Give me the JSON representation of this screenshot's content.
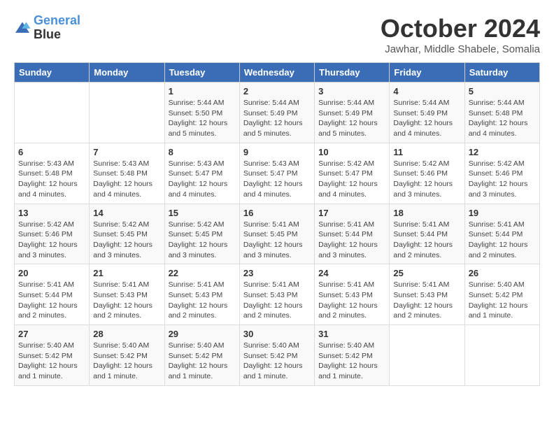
{
  "logo": {
    "line1": "General",
    "line2": "Blue"
  },
  "title": "October 2024",
  "subtitle": "Jawhar, Middle Shabele, Somalia",
  "weekdays": [
    "Sunday",
    "Monday",
    "Tuesday",
    "Wednesday",
    "Thursday",
    "Friday",
    "Saturday"
  ],
  "weeks": [
    [
      null,
      null,
      {
        "day": "1",
        "sunrise": "5:44 AM",
        "sunset": "5:50 PM",
        "daylight": "12 hours and 5 minutes."
      },
      {
        "day": "2",
        "sunrise": "5:44 AM",
        "sunset": "5:49 PM",
        "daylight": "12 hours and 5 minutes."
      },
      {
        "day": "3",
        "sunrise": "5:44 AM",
        "sunset": "5:49 PM",
        "daylight": "12 hours and 5 minutes."
      },
      {
        "day": "4",
        "sunrise": "5:44 AM",
        "sunset": "5:49 PM",
        "daylight": "12 hours and 4 minutes."
      },
      {
        "day": "5",
        "sunrise": "5:44 AM",
        "sunset": "5:48 PM",
        "daylight": "12 hours and 4 minutes."
      }
    ],
    [
      {
        "day": "6",
        "sunrise": "5:43 AM",
        "sunset": "5:48 PM",
        "daylight": "12 hours and 4 minutes."
      },
      {
        "day": "7",
        "sunrise": "5:43 AM",
        "sunset": "5:48 PM",
        "daylight": "12 hours and 4 minutes."
      },
      {
        "day": "8",
        "sunrise": "5:43 AM",
        "sunset": "5:47 PM",
        "daylight": "12 hours and 4 minutes."
      },
      {
        "day": "9",
        "sunrise": "5:43 AM",
        "sunset": "5:47 PM",
        "daylight": "12 hours and 4 minutes."
      },
      {
        "day": "10",
        "sunrise": "5:42 AM",
        "sunset": "5:47 PM",
        "daylight": "12 hours and 4 minutes."
      },
      {
        "day": "11",
        "sunrise": "5:42 AM",
        "sunset": "5:46 PM",
        "daylight": "12 hours and 3 minutes."
      },
      {
        "day": "12",
        "sunrise": "5:42 AM",
        "sunset": "5:46 PM",
        "daylight": "12 hours and 3 minutes."
      }
    ],
    [
      {
        "day": "13",
        "sunrise": "5:42 AM",
        "sunset": "5:46 PM",
        "daylight": "12 hours and 3 minutes."
      },
      {
        "day": "14",
        "sunrise": "5:42 AM",
        "sunset": "5:45 PM",
        "daylight": "12 hours and 3 minutes."
      },
      {
        "day": "15",
        "sunrise": "5:42 AM",
        "sunset": "5:45 PM",
        "daylight": "12 hours and 3 minutes."
      },
      {
        "day": "16",
        "sunrise": "5:41 AM",
        "sunset": "5:45 PM",
        "daylight": "12 hours and 3 minutes."
      },
      {
        "day": "17",
        "sunrise": "5:41 AM",
        "sunset": "5:44 PM",
        "daylight": "12 hours and 3 minutes."
      },
      {
        "day": "18",
        "sunrise": "5:41 AM",
        "sunset": "5:44 PM",
        "daylight": "12 hours and 2 minutes."
      },
      {
        "day": "19",
        "sunrise": "5:41 AM",
        "sunset": "5:44 PM",
        "daylight": "12 hours and 2 minutes."
      }
    ],
    [
      {
        "day": "20",
        "sunrise": "5:41 AM",
        "sunset": "5:44 PM",
        "daylight": "12 hours and 2 minutes."
      },
      {
        "day": "21",
        "sunrise": "5:41 AM",
        "sunset": "5:43 PM",
        "daylight": "12 hours and 2 minutes."
      },
      {
        "day": "22",
        "sunrise": "5:41 AM",
        "sunset": "5:43 PM",
        "daylight": "12 hours and 2 minutes."
      },
      {
        "day": "23",
        "sunrise": "5:41 AM",
        "sunset": "5:43 PM",
        "daylight": "12 hours and 2 minutes."
      },
      {
        "day": "24",
        "sunrise": "5:41 AM",
        "sunset": "5:43 PM",
        "daylight": "12 hours and 2 minutes."
      },
      {
        "day": "25",
        "sunrise": "5:41 AM",
        "sunset": "5:43 PM",
        "daylight": "12 hours and 2 minutes."
      },
      {
        "day": "26",
        "sunrise": "5:40 AM",
        "sunset": "5:42 PM",
        "daylight": "12 hours and 1 minute."
      }
    ],
    [
      {
        "day": "27",
        "sunrise": "5:40 AM",
        "sunset": "5:42 PM",
        "daylight": "12 hours and 1 minute."
      },
      {
        "day": "28",
        "sunrise": "5:40 AM",
        "sunset": "5:42 PM",
        "daylight": "12 hours and 1 minute."
      },
      {
        "day": "29",
        "sunrise": "5:40 AM",
        "sunset": "5:42 PM",
        "daylight": "12 hours and 1 minute."
      },
      {
        "day": "30",
        "sunrise": "5:40 AM",
        "sunset": "5:42 PM",
        "daylight": "12 hours and 1 minute."
      },
      {
        "day": "31",
        "sunrise": "5:40 AM",
        "sunset": "5:42 PM",
        "daylight": "12 hours and 1 minute."
      },
      null,
      null
    ]
  ],
  "labels": {
    "sunrise": "Sunrise:",
    "sunset": "Sunset:",
    "daylight": "Daylight:"
  }
}
